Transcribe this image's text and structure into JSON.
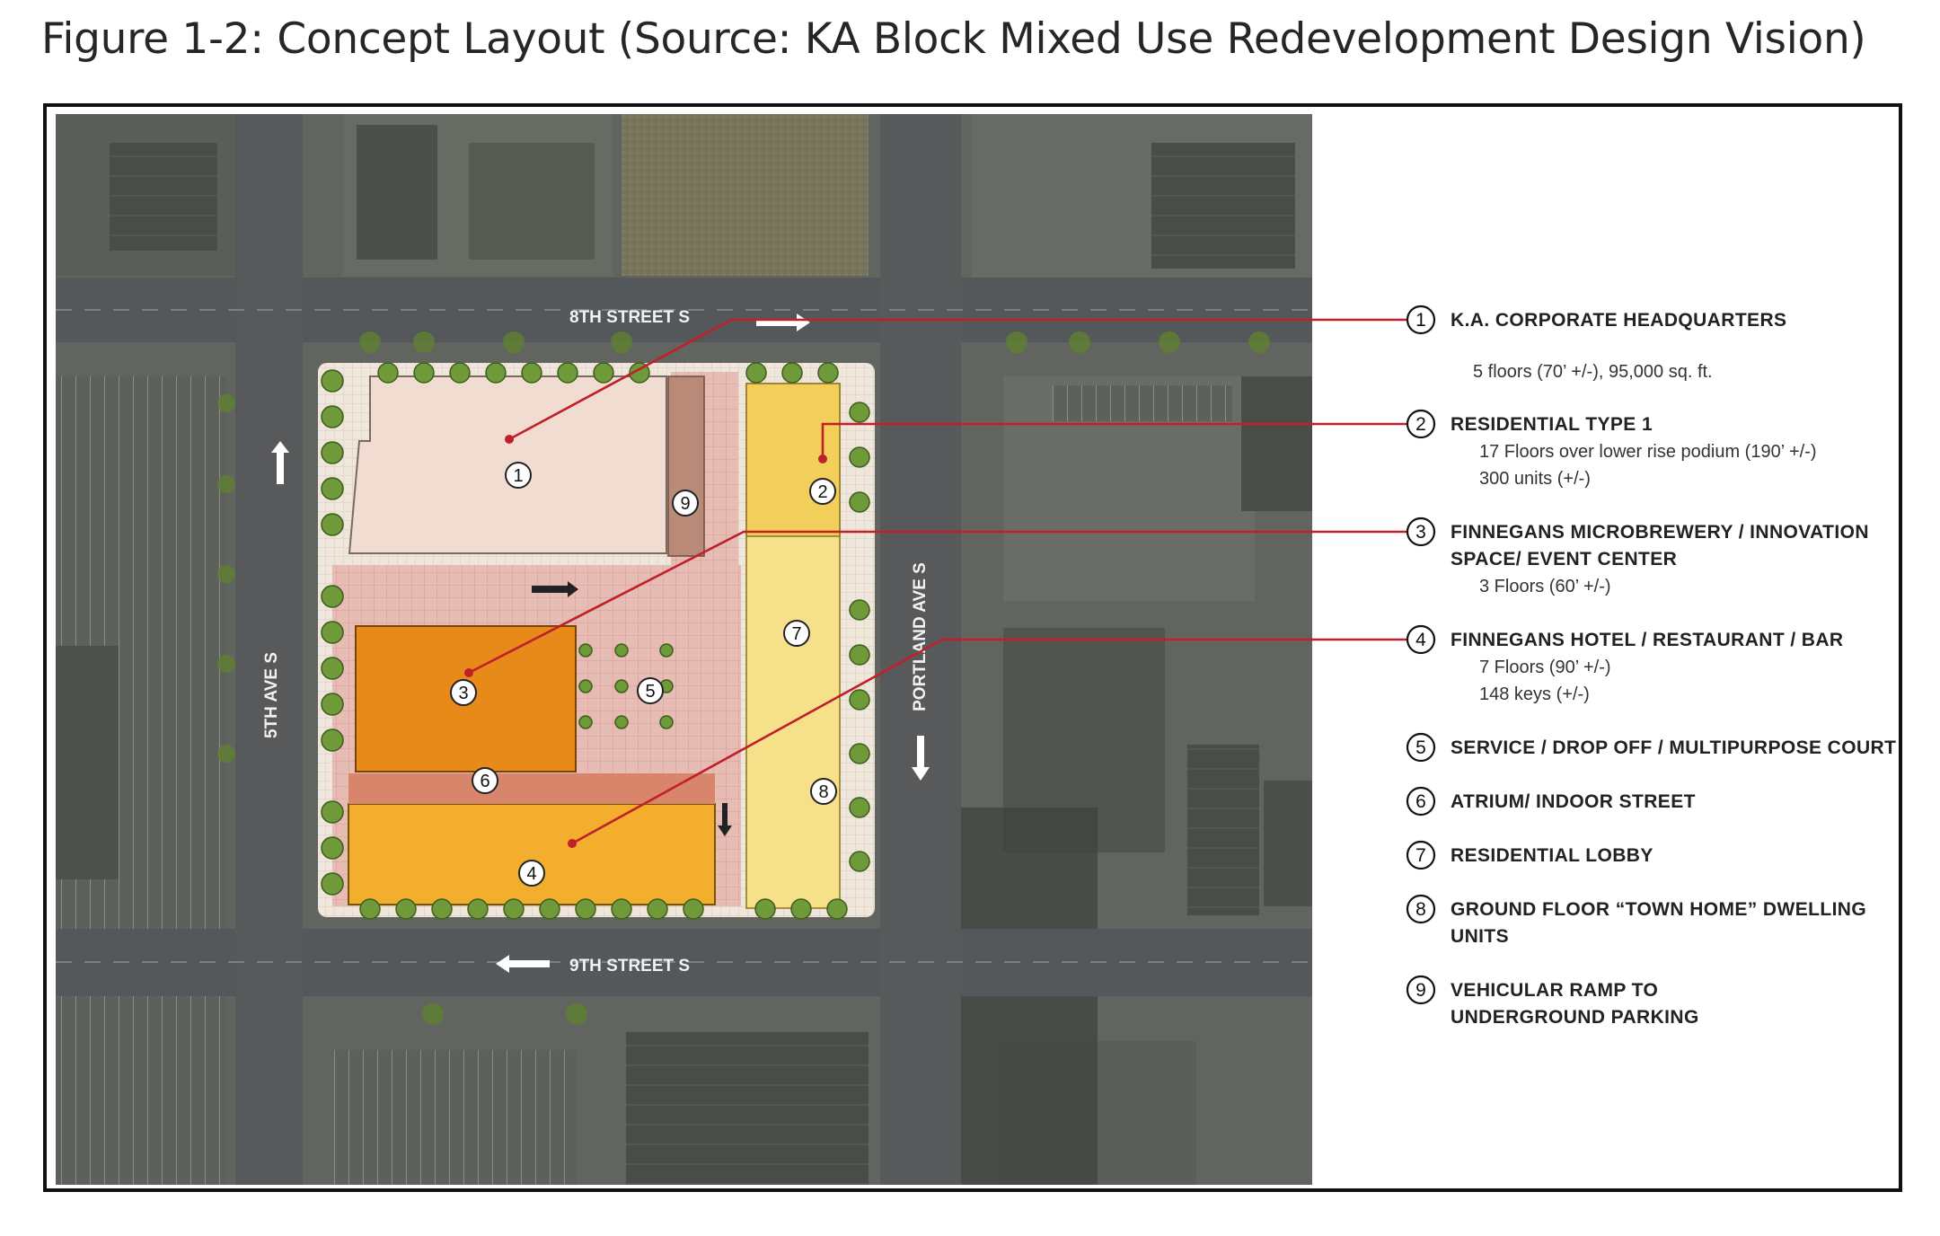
{
  "figure": {
    "title": "Figure 1-2:  Concept Layout (Source: KA Block Mixed Use Redevelopment Design Vision)"
  },
  "map": {
    "streets": {
      "eighth": "8TH STREET S",
      "ninth": "9TH STREET S",
      "fifth_ave": "5TH AVE S",
      "portland_ave": "PORTLAND AVE S"
    },
    "markers": [
      "1",
      "2",
      "3",
      "4",
      "5",
      "6",
      "7",
      "8",
      "9"
    ]
  },
  "legend": [
    {
      "num": "1",
      "title": "K.A. CORPORATE HEADQUARTERS",
      "title2": "",
      "details": [
        "5 floors (70’ +/-), 95,000 sq. ft."
      ]
    },
    {
      "num": "2",
      "title": "RESIDENTIAL TYPE 1",
      "title2": "",
      "details": [
        "17 Floors over lower rise podium  (190’ +/-)",
        "300 units (+/-)"
      ]
    },
    {
      "num": "3",
      "title": "FINNEGANS MICROBREWERY / INNOVATION",
      "title2": "SPACE/ EVENT CENTER",
      "details": [
        "3 Floors (60’ +/-)"
      ]
    },
    {
      "num": "4",
      "title": "FINNEGANS HOTEL / RESTAURANT / BAR",
      "title2": "",
      "details": [
        "7 Floors (90’ +/-)",
        "148 keys (+/-)"
      ]
    },
    {
      "num": "5",
      "title": "SERVICE / DROP OFF / MULTIPURPOSE COURT",
      "title2": "",
      "details": []
    },
    {
      "num": "6",
      "title": "ATRIUM/ INDOOR STREET",
      "title2": "",
      "details": []
    },
    {
      "num": "7",
      "title": "RESIDENTIAL LOBBY",
      "title2": "",
      "details": []
    },
    {
      "num": "8",
      "title": "GROUND FLOOR “TOWN HOME” DWELLING",
      "title2": "UNITS",
      "details": []
    },
    {
      "num": "9",
      "title": "VEHICULAR RAMP TO",
      "title2": "UNDERGROUND PARKING",
      "details": []
    }
  ],
  "colors": {
    "leader": "#c0202a",
    "hq": "#f1dcd2",
    "brewery": "#e88a1a",
    "hotel": "#f2ae2c",
    "residential": "#f7e08a",
    "plaza": "#e3b6b0",
    "street": "#55585a",
    "aerial_ground": "#6b6d66",
    "trees": "#6f9a3a"
  }
}
